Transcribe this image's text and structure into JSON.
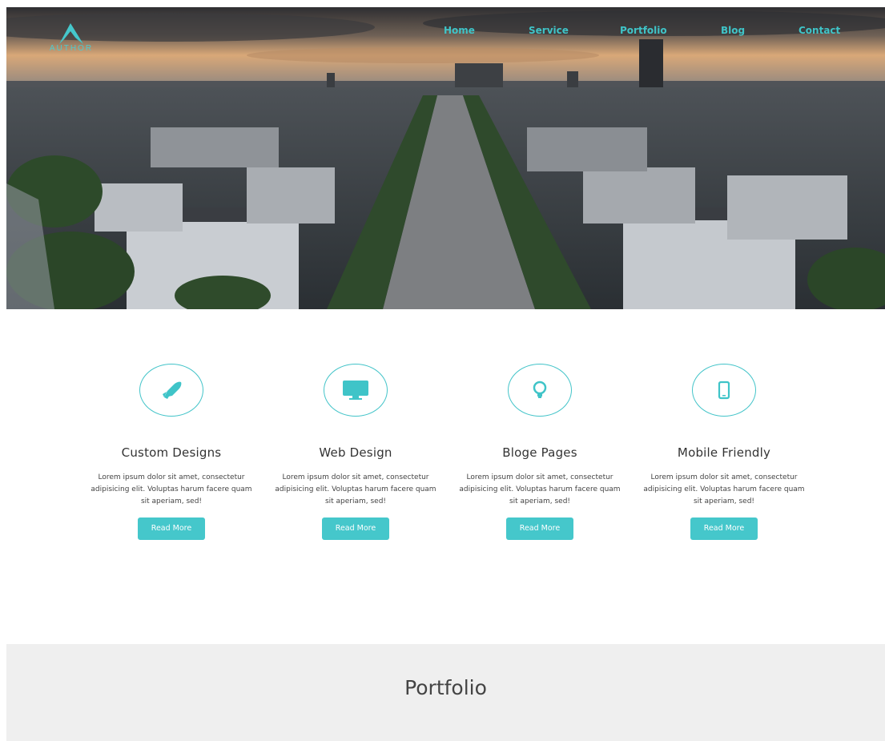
{
  "brand": {
    "logo_text": "AUTHOR",
    "accent_color": "#45c7cb"
  },
  "nav": {
    "items": [
      {
        "label": "Home"
      },
      {
        "label": "Service"
      },
      {
        "label": "Portfolio"
      },
      {
        "label": "Blog"
      },
      {
        "label": "Contact"
      }
    ]
  },
  "hero": {
    "image": "city-aerial-photo"
  },
  "services": [
    {
      "icon": "rocket-icon",
      "title": "Custom Designs",
      "text": "Lorem ipsum dolor sit amet, consectetur adipisicing elit. Voluptas harum facere quam sit aperiam, sed!",
      "button": "Read More"
    },
    {
      "icon": "monitor-icon",
      "title": "Web Design",
      "text": "Lorem ipsum dolor sit amet, consectetur adipisicing elit. Voluptas harum facere quam sit aperiam, sed!",
      "button": "Read More"
    },
    {
      "icon": "lightbulb-icon",
      "title": "Bloge Pages",
      "text": "Lorem ipsum dolor sit amet, consectetur adipisicing elit. Voluptas harum facere quam sit aperiam, sed!",
      "button": "Read More"
    },
    {
      "icon": "mobile-icon",
      "title": "Mobile Friendly",
      "text": "Lorem ipsum dolor sit amet, consectetur adipisicing elit. Voluptas harum facere quam sit aperiam, sed!",
      "button": "Read More"
    }
  ],
  "portfolio": {
    "title": "Portfolio"
  }
}
